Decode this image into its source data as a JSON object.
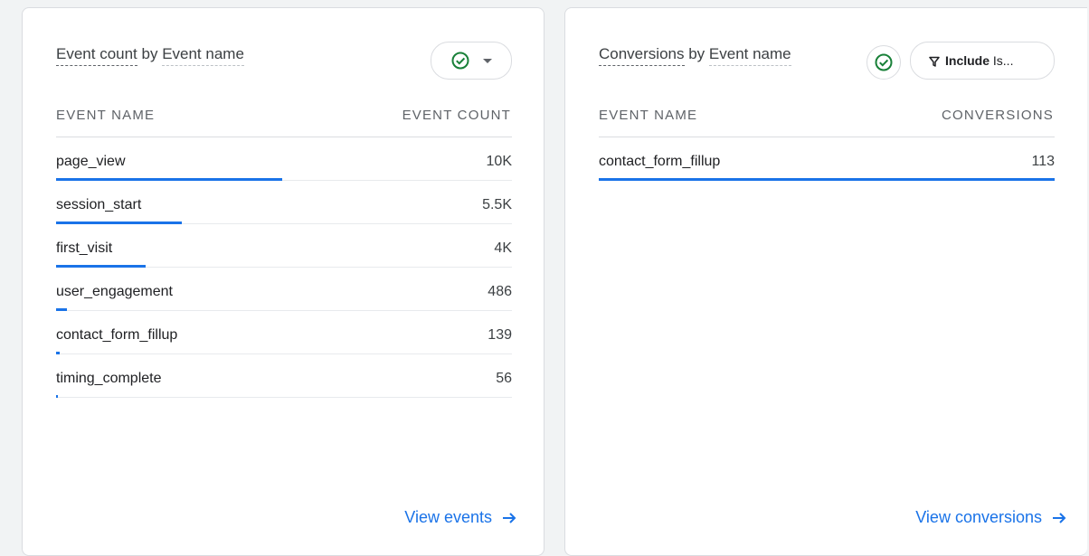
{
  "events_card": {
    "title_part1": "Event count by ",
    "title_dim": "Event name",
    "title_metric": "Event count",
    "col_name": "EVENT NAME",
    "col_value": "EVENT COUNT",
    "rows": [
      {
        "name": "page_view",
        "value": "10K",
        "fraction": 0.496
      },
      {
        "name": "session_start",
        "value": "5.5K",
        "fraction": 0.276
      },
      {
        "name": "first_visit",
        "value": "4K",
        "fraction": 0.196
      },
      {
        "name": "user_engagement",
        "value": "486",
        "fraction": 0.024
      },
      {
        "name": "contact_form_fillup",
        "value": "139",
        "fraction": 0.008
      },
      {
        "name": "timing_complete",
        "value": "56",
        "fraction": 0.004
      }
    ],
    "link_label": "View events"
  },
  "conversions_card": {
    "title_metric": "Conversions",
    "title_by": " by ",
    "title_dim": "Event name",
    "filter_bold": "Include",
    "filter_rest": " Is...",
    "col_name": "EVENT NAME",
    "col_value": "CONVERSIONS",
    "rows": [
      {
        "name": "contact_form_fillup",
        "value": "113",
        "fraction": 1.0
      }
    ],
    "link_label": "View conversions"
  },
  "colors": {
    "accent": "#1a73e8",
    "check": "#188038"
  }
}
